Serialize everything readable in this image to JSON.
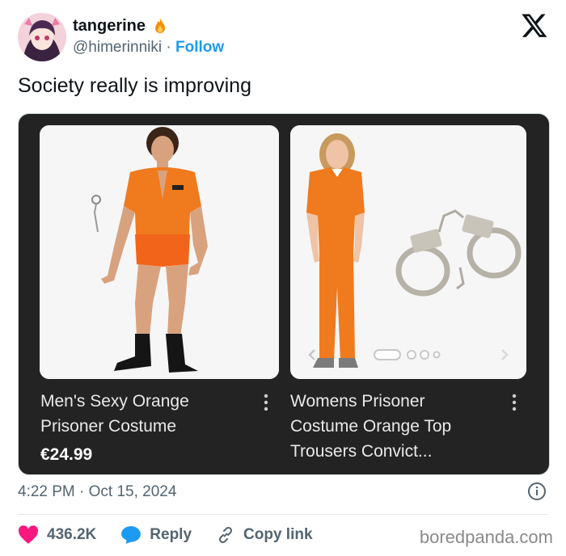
{
  "header": {
    "display_name": "tangerine",
    "handle": "@himerinniki",
    "separator": "·",
    "follow_label": "Follow"
  },
  "tweet": {
    "text": "Society really is improving"
  },
  "products": [
    {
      "title": "Men's Sexy Orange\nPrisoner Costume",
      "price": "€24.99"
    },
    {
      "title": "Womens Prisoner\nCostume Orange Top\nTrousers Convict..."
    }
  ],
  "meta": {
    "timestamp": "4:22 PM · Oct 15, 2024"
  },
  "actions": {
    "like_count": "436.2K",
    "reply_label": "Reply",
    "copy_label": "Copy link"
  },
  "watermark": "boredpanda.com",
  "colors": {
    "accent": "#1d9bf0",
    "like": "#f91880",
    "orange": "#f07a1e"
  }
}
